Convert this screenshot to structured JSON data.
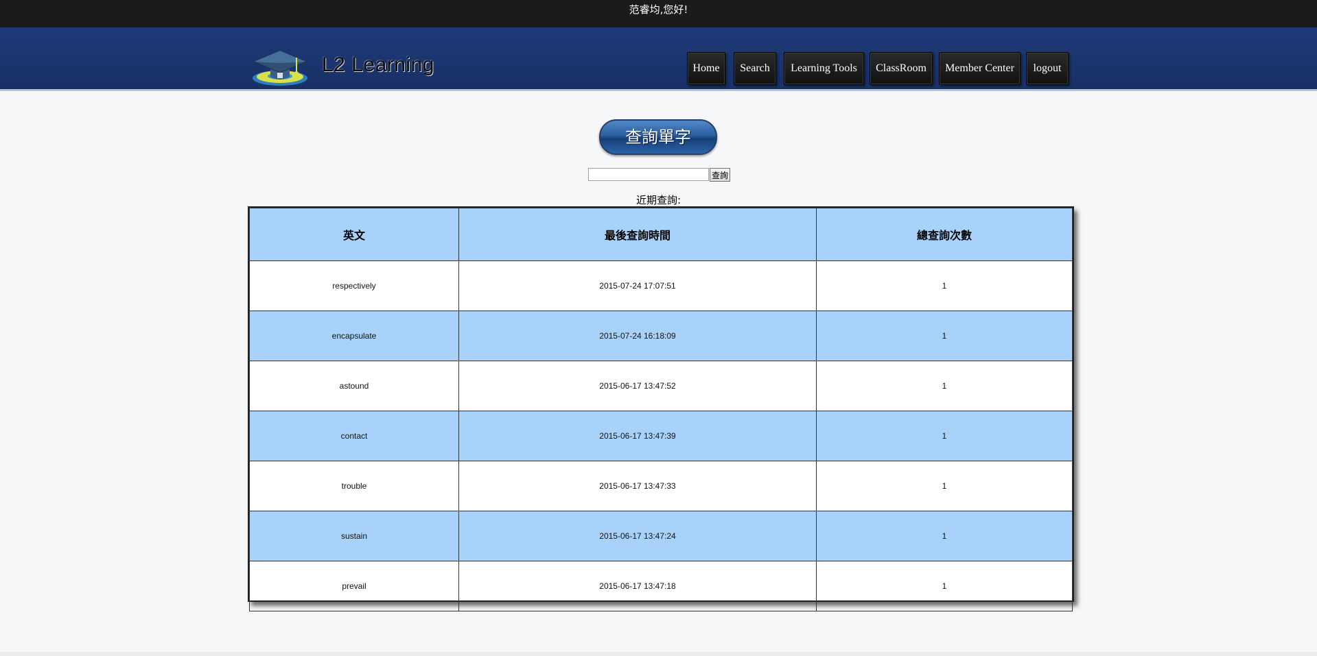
{
  "topbar": {
    "greeting": "范睿均,您好!"
  },
  "header": {
    "logo_text": "L2 Learning",
    "nav": [
      {
        "label": "Home"
      },
      {
        "label": "Search"
      },
      {
        "label": "Learning Tools"
      },
      {
        "label": "ClassRoom"
      },
      {
        "label": "Member Center"
      },
      {
        "label": "logout"
      }
    ]
  },
  "search": {
    "title": "查詢單字",
    "input_value": "",
    "button_label": "查詢"
  },
  "recent": {
    "label": "近期查詢:",
    "columns": [
      "英文",
      "最後查詢時間",
      "總查詢次數"
    ],
    "rows": [
      [
        "respectively",
        "2015-07-24 17:07:51",
        "1"
      ],
      [
        "encapsulate",
        "2015-07-24 16:18:09",
        "1"
      ],
      [
        "astound",
        "2015-06-17 13:47:52",
        "1"
      ],
      [
        "contact",
        "2015-06-17 13:47:39",
        "1"
      ],
      [
        "trouble",
        "2015-06-17 13:47:33",
        "1"
      ],
      [
        "sustain",
        "2015-06-17 13:47:24",
        "1"
      ],
      [
        "prevail",
        "2015-06-17 13:47:18",
        "1"
      ]
    ]
  },
  "colors": {
    "topbar": "#1b1b1b",
    "header": "#1e3a78",
    "table_header": "#a9d2fb",
    "table_alt_row": "#a9d2fb",
    "nav_button": "#1a1a1a"
  },
  "icons": {
    "logo": "graduation-cap-icon"
  }
}
